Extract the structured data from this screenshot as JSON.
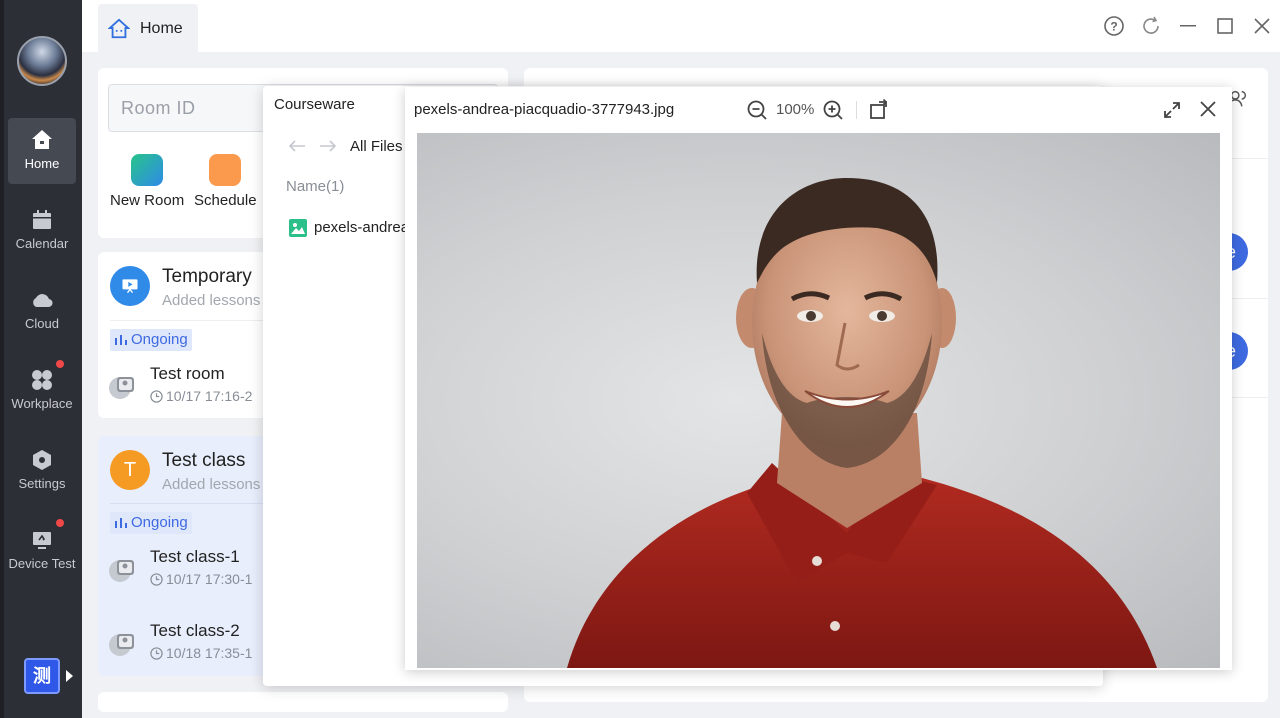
{
  "sidebar": {
    "items": [
      {
        "label": "Home",
        "icon": "home-icon",
        "active": true
      },
      {
        "label": "Calendar",
        "icon": "calendar-icon"
      },
      {
        "label": "Cloud",
        "icon": "cloud-icon"
      },
      {
        "label": "Workplace",
        "icon": "workplace-icon",
        "dot": true
      },
      {
        "label": "Settings",
        "icon": "settings-icon"
      },
      {
        "label": "Device Test",
        "icon": "device-test-icon",
        "dot": true
      }
    ],
    "bottom_badge": "测"
  },
  "topbar": {
    "tab_label": "Home"
  },
  "home": {
    "room_id_placeholder": "Room ID",
    "new_room_label": "New Room",
    "schedule_label": "Schedule"
  },
  "cards": [
    {
      "title": "Temporary",
      "subtitle": "Added lessons",
      "status": "Ongoing",
      "lessons": [
        {
          "title": "Test room",
          "time": "10/17 17:16-2"
        }
      ]
    },
    {
      "title": "Test class",
      "avatar_letter": "T",
      "subtitle": "Added lessons",
      "status": "Ongoing",
      "lessons": [
        {
          "title": "Test class-1",
          "time": "10/17 17:30-1"
        },
        {
          "title": "Test class-2",
          "time": "10/18 17:35-1"
        }
      ]
    }
  ],
  "right_panel": {
    "pill_1": "e",
    "pill_2": "e"
  },
  "courseware": {
    "title": "Courseware",
    "breadcrumb": "All Files",
    "column_name": "Name(1)",
    "file_name": "pexels-andrea"
  },
  "preview": {
    "file_name": "pexels-andrea-piacquadio-3777943.jpg",
    "zoom": "100%"
  },
  "colors": {
    "sidebar_bg": "#2c2f36",
    "accent_blue": "#3e6ae1",
    "orange": "#f59a23",
    "red_shirt": "#a8201a"
  }
}
